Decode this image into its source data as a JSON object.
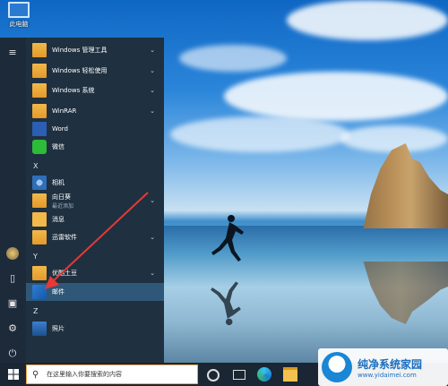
{
  "desktop": {
    "icon_label": "此电脑"
  },
  "start_menu": {
    "rows": [
      {
        "name": "Windows 管理工具",
        "chevron": "⌄"
      },
      {
        "name": "Windows 轻松使用",
        "chevron": "⌄"
      },
      {
        "name": "Windows 系统",
        "chevron": "⌄"
      },
      {
        "name": "WinRAR",
        "chevron": "⌄"
      },
      {
        "name": "Word",
        "chevron": ""
      },
      {
        "name": "微信",
        "chevron": ""
      },
      {
        "letter": "X"
      },
      {
        "name": "相机",
        "chevron": ""
      },
      {
        "name": "向日葵",
        "sub": "最近添加",
        "chevron": "⌄"
      },
      {
        "name": "消息",
        "chevron": ""
      },
      {
        "name": "迅雷软件",
        "chevron": "⌄"
      },
      {
        "letter": "Y"
      },
      {
        "name": "优酷土豆",
        "chevron": "⌄"
      },
      {
        "name": "邮件",
        "chevron": "",
        "highlight": true
      },
      {
        "letter": "Z"
      },
      {
        "name": "照片",
        "chevron": ""
      }
    ]
  },
  "taskbar": {
    "search_placeholder": "在这里输入你要搜索的内容"
  },
  "watermark": {
    "title": "纯净系统家园",
    "url": "www.yidaimei.com"
  },
  "colors": {
    "accent": "#2f5878",
    "arrow": "#e53935",
    "search_border": "#f0a84a"
  }
}
